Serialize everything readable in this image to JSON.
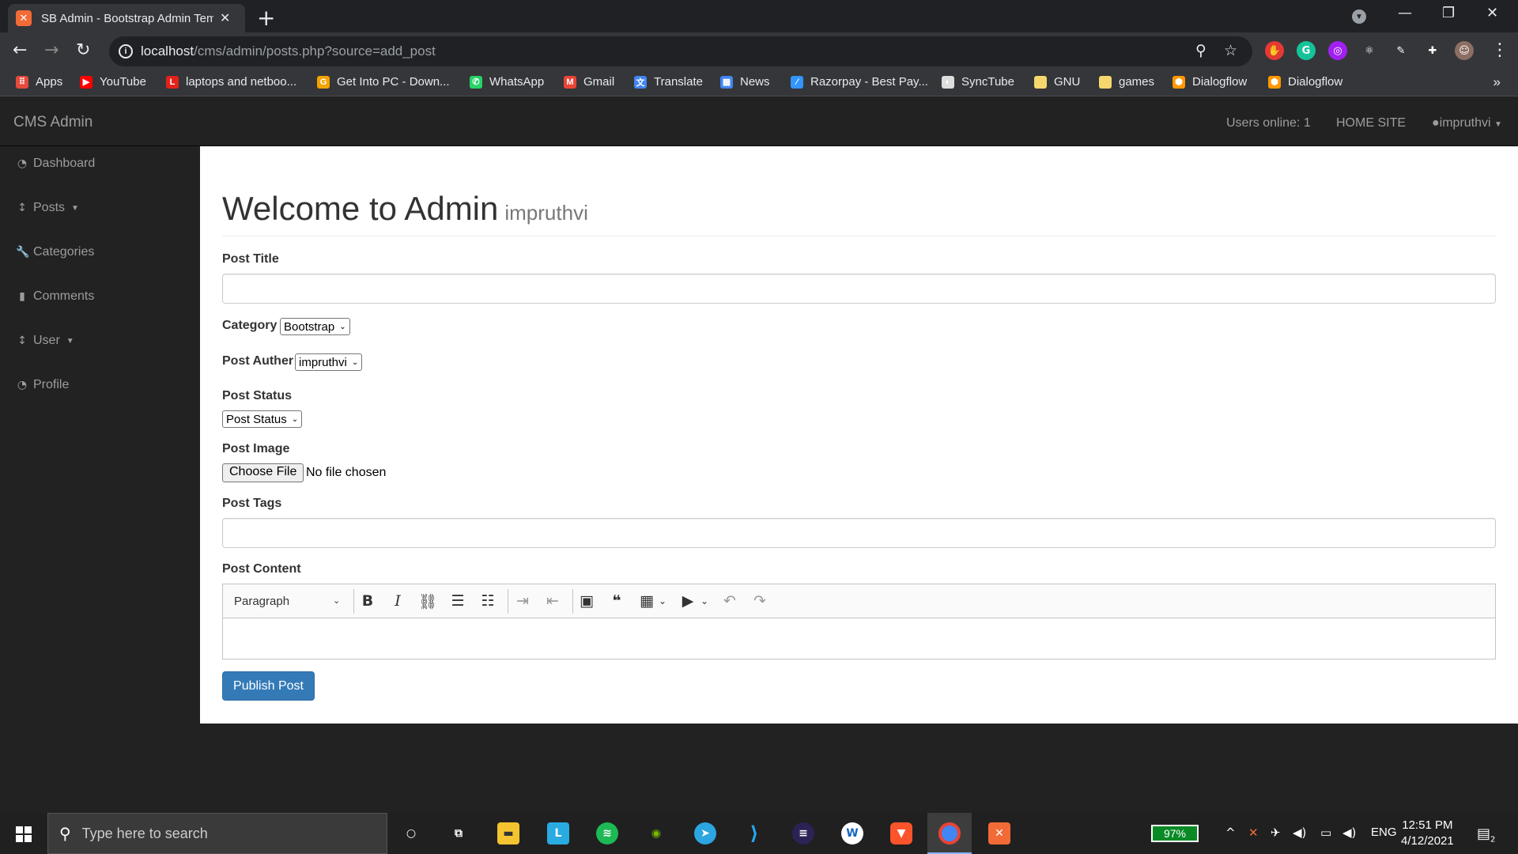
{
  "browser": {
    "tab_title": "SB Admin - Bootstrap Admin Template",
    "tab_favicon": "xampp-icon",
    "url_host": "localhost",
    "url_path": "/cms/admin/posts.php?source=add_post",
    "bookmarks": [
      {
        "label": "Apps",
        "icon": "apps-icon",
        "color": "#e44b3c"
      },
      {
        "label": "YouTube",
        "icon": "youtube-icon",
        "color": "#ff0000"
      },
      {
        "label": "laptops and netboo...",
        "icon": "lenovo-icon",
        "color": "#e2231a"
      },
      {
        "label": "Get Into PC - Down...",
        "icon": "g-icon",
        "color": "#f4a300"
      },
      {
        "label": "WhatsApp",
        "icon": "whatsapp-icon",
        "color": "#25d366"
      },
      {
        "label": "Gmail",
        "icon": "gmail-icon",
        "color": "#ea4335"
      },
      {
        "label": "Translate",
        "icon": "translate-icon",
        "color": "#4285f4"
      },
      {
        "label": "News",
        "icon": "news-icon",
        "color": "#4285f4"
      },
      {
        "label": "Razorpay - Best Pay...",
        "icon": "razorpay-icon",
        "color": "#3395ff"
      },
      {
        "label": "SyncTube",
        "icon": "synctube-icon",
        "color": "#dddddd"
      },
      {
        "label": "GNU",
        "icon": "folder-icon",
        "color": "#f5d76e"
      },
      {
        "label": "games",
        "icon": "folder-icon",
        "color": "#f5d76e"
      },
      {
        "label": "Dialogflow",
        "icon": "dialogflow-icon",
        "color": "#ff9800"
      },
      {
        "label": "Dialogflow",
        "icon": "dialogflow-icon",
        "color": "#ff9800"
      }
    ]
  },
  "cms": {
    "brand": "CMS Admin",
    "users_online": "Users online: 1",
    "home_site": "HOME SITE",
    "user": "impruthvi",
    "sidebar": [
      {
        "label": "Dashboard",
        "icon": "dashboard-icon",
        "caret": false
      },
      {
        "label": "Posts",
        "icon": "arrows-v-icon",
        "caret": true
      },
      {
        "label": "Categories",
        "icon": "wrench-icon",
        "caret": false
      },
      {
        "label": "Comments",
        "icon": "file-icon",
        "caret": false
      },
      {
        "label": "User",
        "icon": "arrows-v-icon",
        "caret": true
      },
      {
        "label": "Profile",
        "icon": "dashboard-icon",
        "caret": false
      }
    ],
    "heading": "Welcome to Admin",
    "heading_sub": "impruthvi",
    "form": {
      "post_title_label": "Post Title",
      "category_label": "Category",
      "category_value": "Bootstrap",
      "author_label": "Post Auther",
      "author_value": "impruthvi",
      "status_label": "Post Status",
      "status_value": "Post Status",
      "image_label": "Post Image",
      "choose_file": "Choose File",
      "no_file": "No file chosen",
      "tags_label": "Post Tags",
      "content_label": "Post Content",
      "editor_heading": "Paragraph",
      "publish": "Publish Post"
    }
  },
  "taskbar": {
    "search_placeholder": "Type here to search",
    "battery": "97%",
    "lang": "ENG",
    "time": "12:51 PM",
    "date": "4/12/2021",
    "notifications": "2"
  }
}
